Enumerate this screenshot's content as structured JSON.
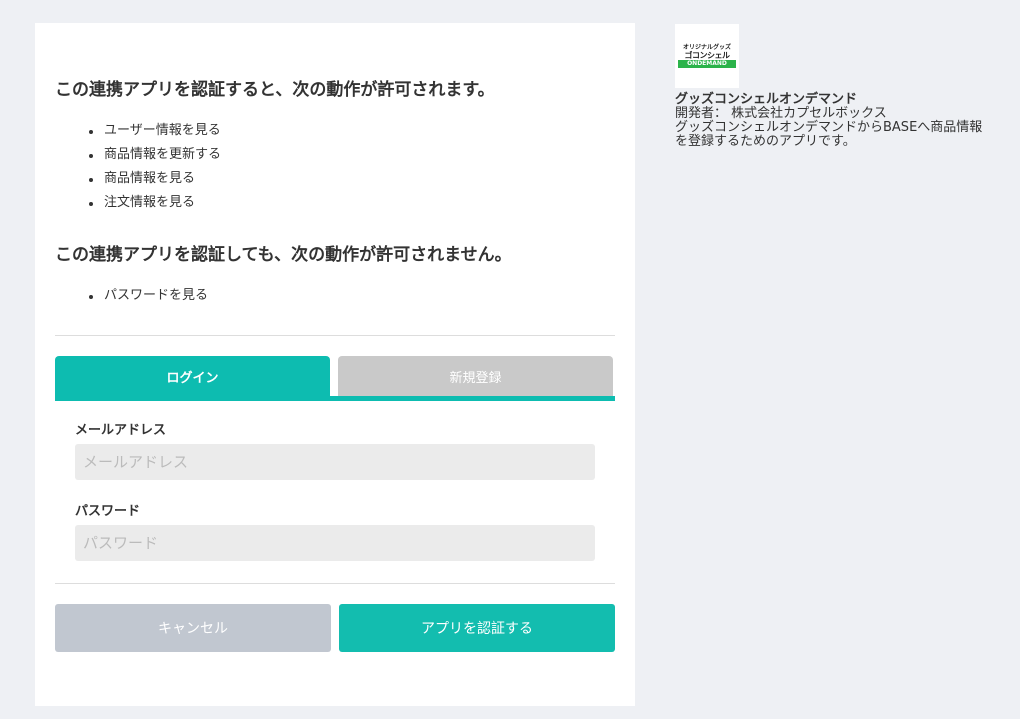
{
  "permissions": {
    "allowed_heading": "この連携アプリを認証すると、次の動作が許可されます。",
    "allowed": [
      "ユーザー情報を見る",
      "商品情報を更新する",
      "商品情報を見る",
      "注文情報を見る"
    ],
    "denied_heading": "この連携アプリを認証しても、次の動作が許可されません。",
    "denied": [
      "パスワードを見る"
    ]
  },
  "tabs": {
    "login": "ログイン",
    "register": "新規登録",
    "active": "login"
  },
  "form": {
    "email_label": "メールアドレス",
    "email_placeholder": "メールアドレス",
    "email_value": "",
    "password_label": "パスワード",
    "password_placeholder": "パスワード",
    "password_value": ""
  },
  "buttons": {
    "cancel": "キャンセル",
    "authorize": "アプリを認証する"
  },
  "app": {
    "logo_line1": "オリジナルグッズ",
    "logo_line2": "ゴコンシェル",
    "logo_line3": "ONDEMAND",
    "name": "グッズコンシェルオンデマンド",
    "developer": "開発者： 株式会社カプセルボックス",
    "description": "グッズコンシェルオンデマンドからBASEへ商品情報を登録するためのアプリです。"
  },
  "colors": {
    "accent": "#0dbcb0",
    "tab_inactive": "#c9c9c9",
    "cancel": "#c1c7d0",
    "background": "#eef0f4",
    "logo_green": "#2bb34a"
  }
}
